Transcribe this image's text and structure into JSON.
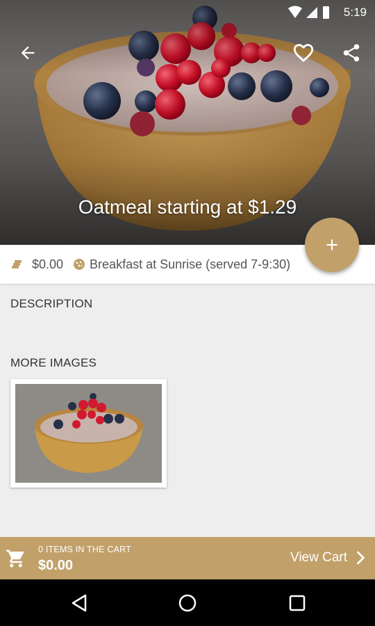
{
  "status_bar": {
    "time": "5:19"
  },
  "header": {
    "title": "Oatmeal starting at $1.29",
    "back_icon": "back-arrow-icon",
    "favorite_icon": "heart-outline-icon",
    "share_icon": "share-icon"
  },
  "fab": {
    "icon": "plus-icon",
    "color": "#c1a06a"
  },
  "info": {
    "price": "$0.00",
    "menu": "Breakfast at Sunrise (served 7-9:30)",
    "price_icon": "coins-icon",
    "menu_icon": "cookie-icon"
  },
  "sections": {
    "description_label": "DESCRIPTION",
    "more_images_label": "MORE IMAGES"
  },
  "cart": {
    "items_label": "0 ITEMS IN THE CART",
    "total": "$0.00",
    "view_cart_label": "View Cart",
    "color": "#c1a06a"
  },
  "colors": {
    "accent": "#c1a06a",
    "background": "#eeeeee"
  }
}
